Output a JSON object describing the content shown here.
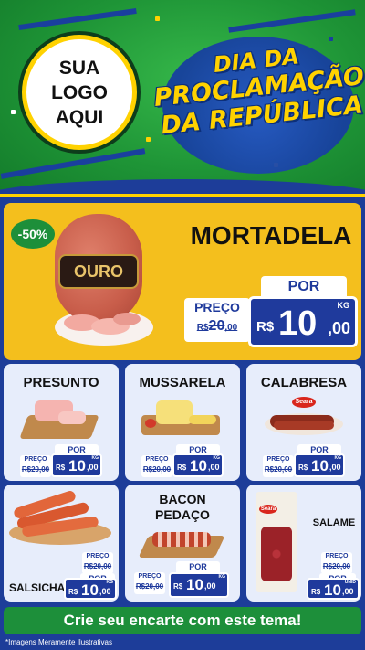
{
  "header": {
    "logo_lines": [
      "SUA",
      "LOGO",
      "AQUI"
    ],
    "title_lines": [
      "DIA DA",
      "PROCLAMAÇÃO",
      "DA REPÚBLICA"
    ]
  },
  "featured": {
    "discount_badge": "-50%",
    "brand_label": "OURO",
    "name": "MORTADELA",
    "por_label": "POR",
    "preco_label": "PREÇO",
    "old_price_cur": "R$",
    "old_price_int": "20",
    "old_price_dec": ",00",
    "currency": "R$",
    "price_int": "10",
    "price_dec": ",00",
    "unit": "KG"
  },
  "products": [
    {
      "name": "PRESUNTO",
      "preco_label": "PREÇO",
      "old_price": "R$20,00",
      "por_label": "POR",
      "currency": "R$",
      "price_int": "10",
      "price_dec": ",00",
      "unit": "KG"
    },
    {
      "name": "MUSSARELA",
      "preco_label": "PREÇO",
      "old_price": "R$20,00",
      "por_label": "POR",
      "currency": "R$",
      "price_int": "10",
      "price_dec": ",00",
      "unit": "KG"
    },
    {
      "name": "CALABRESA",
      "brand": "Seara",
      "preco_label": "PREÇO",
      "old_price": "R$20,00",
      "por_label": "POR",
      "currency": "R$",
      "price_int": "10",
      "price_dec": ",00",
      "unit": "KG"
    },
    {
      "name": "SALSICHA",
      "preco_label": "PREÇO",
      "old_price": "R$20,00",
      "por_label": "POR",
      "currency": "R$",
      "price_int": "10",
      "price_dec": ",00",
      "unit": "KG"
    },
    {
      "name_lines": [
        "BACON",
        "PEDAÇO"
      ],
      "preco_label": "PREÇO",
      "old_price": "R$20,00",
      "por_label": "POR",
      "currency": "R$",
      "price_int": "10",
      "price_dec": ",00",
      "unit": "KG"
    },
    {
      "name": "SALAME",
      "brand": "Seara",
      "preco_label": "PREÇO",
      "old_price": "R$20,00",
      "por_label": "POR",
      "currency": "R$",
      "price_int": "10",
      "price_dec": ",00",
      "unit": "UNID"
    }
  ],
  "cta": "Crie seu encarte com este tema!",
  "footer_note": "*Imagens Meramente Ilustrativas",
  "colors": {
    "header_green": "#1e9436",
    "background_blue": "#1d3d99",
    "featured_yellow": "#f4bf1d",
    "price_blue": "#1f3a9c",
    "card_bg": "#e7edfb",
    "accent_yellow": "#ffd200",
    "cta_green": "#1d8f3a"
  }
}
